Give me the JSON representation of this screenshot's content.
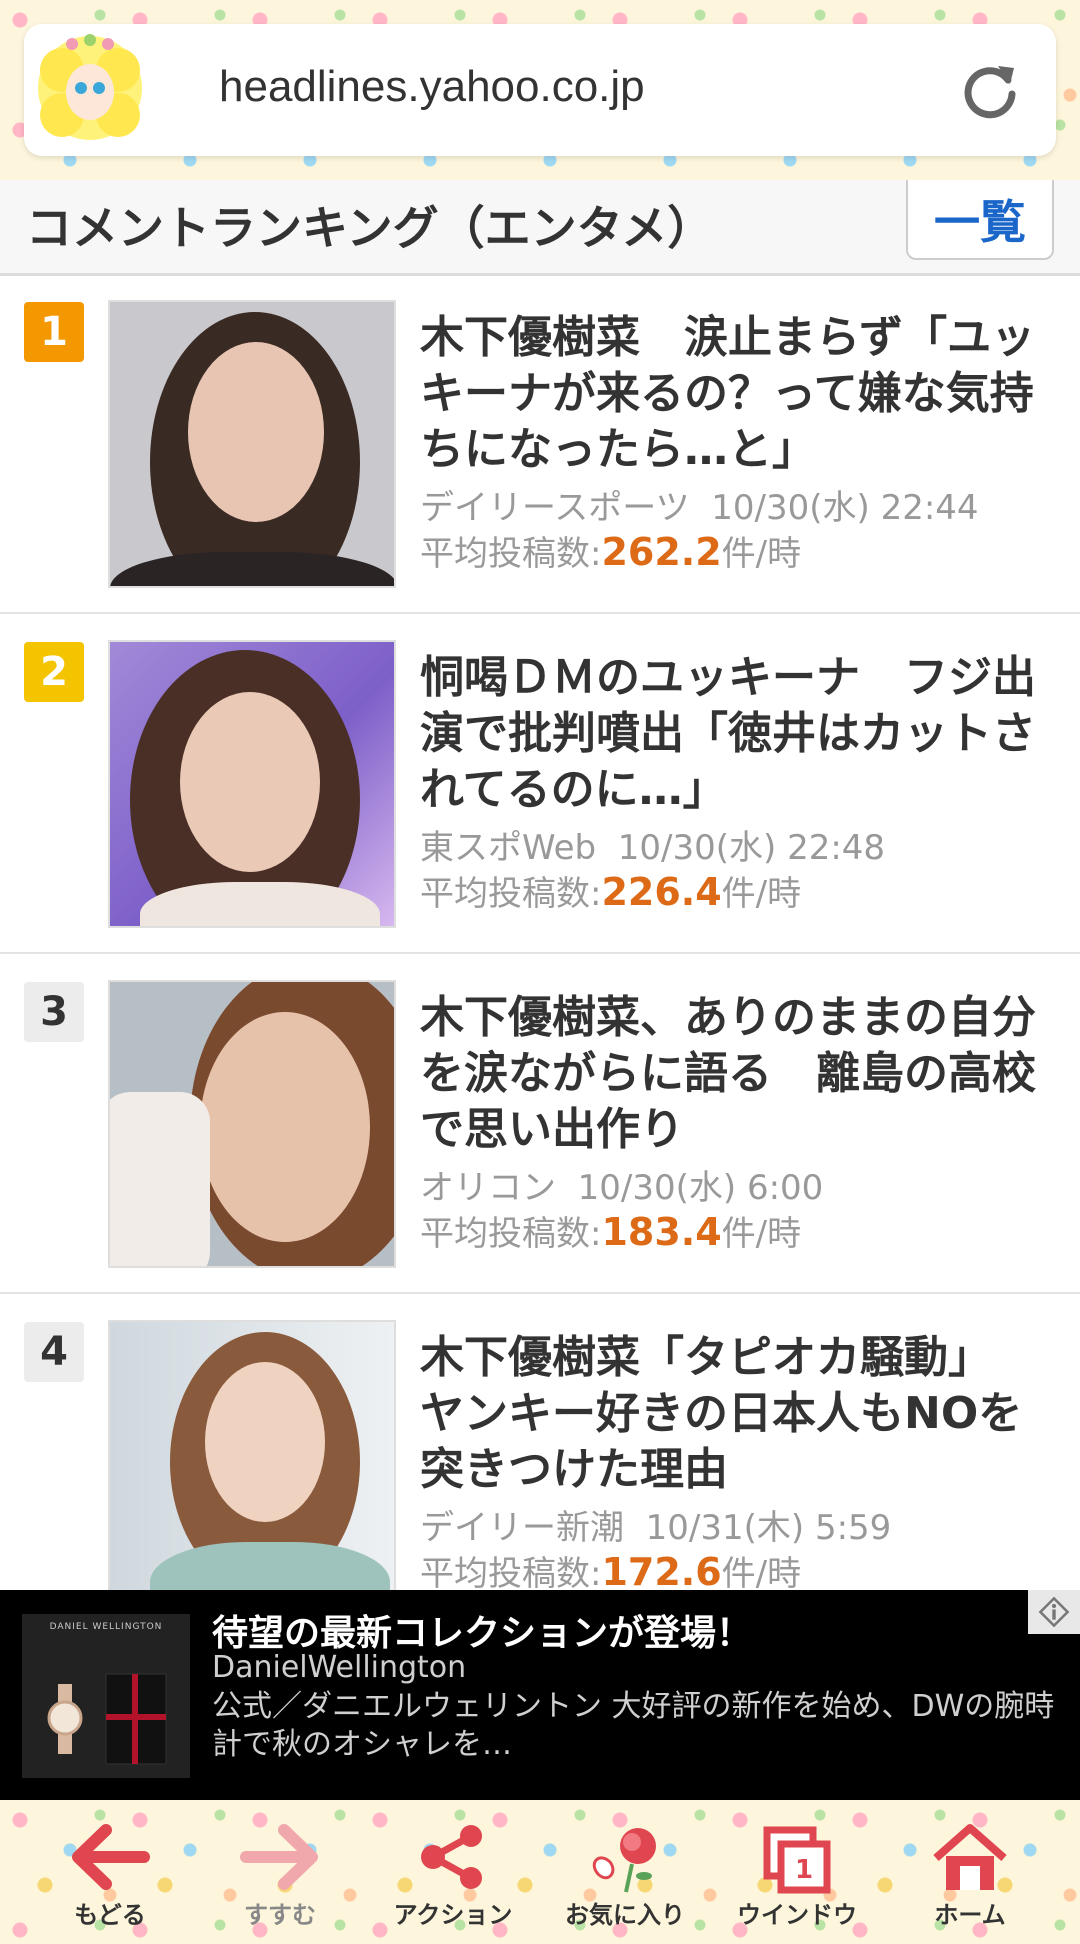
{
  "browser": {
    "url": "headlines.yahoo.co.jp"
  },
  "section": {
    "title": "コメントランキング（エンタメ）",
    "list_button": "一覧"
  },
  "items": [
    {
      "rank": "1",
      "rank_color": "#f39800",
      "headline": "木下優樹菜　涙止まらず「ユッキーナが来るの？って嫌な気持ちになったら…と」",
      "source": "デイリースポーツ",
      "time": "10/30(水) 22:44",
      "stat_label": "平均投稿数:",
      "stat_value": "262.2",
      "stat_unit": "件/時"
    },
    {
      "rank": "2",
      "rank_color": "#f5c400",
      "headline": "恫喝ＤＭのユッキーナ　フジ出演で批判噴出「徳井はカットされてるのに…」",
      "source": "東スポWeb",
      "time": "10/30(水) 22:48",
      "stat_label": "平均投稿数:",
      "stat_value": "226.4",
      "stat_unit": "件/時"
    },
    {
      "rank": "3",
      "rank_color": "#ececec",
      "headline": "木下優樹菜、ありのままの自分を涙ながらに語る　離島の高校で思い出作り",
      "source": "オリコン",
      "time": "10/30(水) 6:00",
      "stat_label": "平均投稿数:",
      "stat_value": "183.4",
      "stat_unit": "件/時"
    },
    {
      "rank": "4",
      "rank_color": "#ececec",
      "headline": "木下優樹菜「タピオカ騒動」　ヤンキー好きの日本人もNOを突きつけた理由",
      "source": "デイリー新潮",
      "time": "10/31(木) 5:59",
      "stat_label": "平均投稿数:",
      "stat_value": "172.6",
      "stat_unit": "件/時"
    }
  ],
  "ad": {
    "title": "待望の最新コレクションが登場！",
    "brand": "DanielWellington",
    "description": "公式／ダニエルウェリントン 大好評の新作を始め、DWの腕時計で秋のオシャレを…",
    "thumb_brand": "DANIEL WELLINGTON"
  },
  "bottom_nav": {
    "back": "もどる",
    "forward": "すすむ",
    "action": "アクション",
    "favorites": "お気に入り",
    "window": "ウインドウ",
    "window_count": "1",
    "home": "ホーム"
  },
  "colors": {
    "accent_orange": "#dd6a17",
    "link_blue": "#1a66c9",
    "nav_red": "#e0464f"
  }
}
